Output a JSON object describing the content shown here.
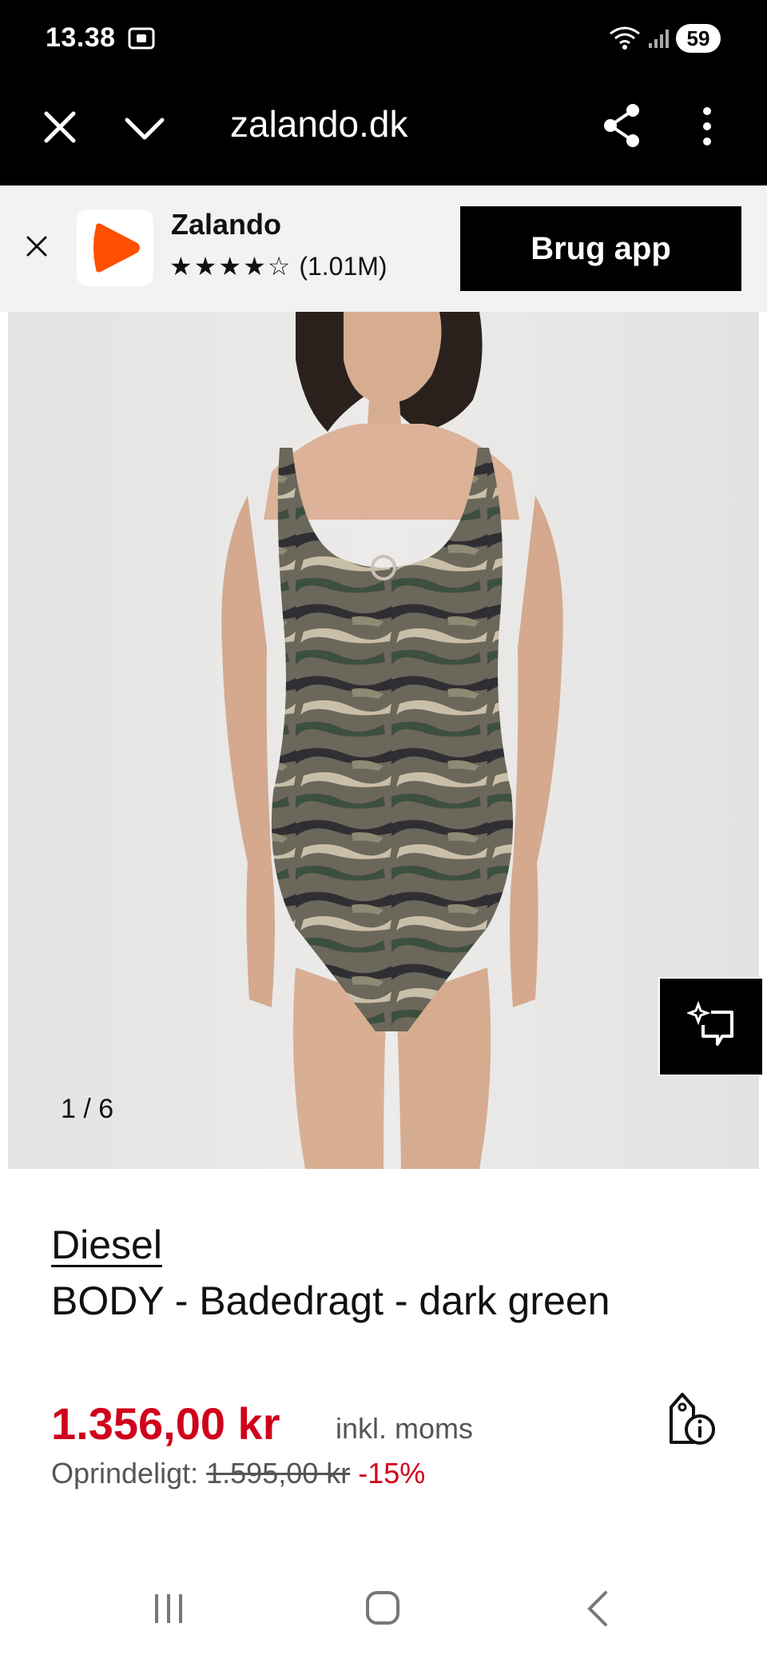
{
  "status_bar": {
    "time": "13.38",
    "battery": "59"
  },
  "browser": {
    "url": "zalando.dk"
  },
  "app_banner": {
    "app_name": "Zalando",
    "stars": "★★★★☆",
    "rating_count": "(1.01M)",
    "cta_label": "Brug app"
  },
  "gallery": {
    "counter": "1 / 6"
  },
  "product": {
    "brand": "Diesel",
    "title": "BODY - Badedragt - dark green",
    "price": "1.356,00 kr",
    "vat_note": "inkl. moms",
    "original_label": "Oprindeligt:",
    "original_price": "1.595,00 kr",
    "discount": "-15%"
  },
  "colors": {
    "price_red": "#d0021b",
    "zalando_orange": "#ff4f00"
  },
  "icons": [
    "close-icon",
    "chevron-down-icon",
    "share-icon",
    "more-vertical-icon",
    "zalando-logo-icon",
    "ai-sparkle-icon",
    "price-tag-info-icon",
    "nav-recents-icon",
    "nav-home-icon",
    "nav-back-icon"
  ]
}
